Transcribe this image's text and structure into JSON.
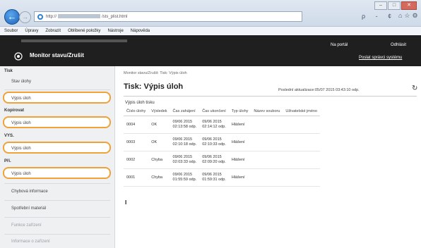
{
  "browser": {
    "address_text": "http://",
    "address_suffix": "/sts_plist.html",
    "search_hint": "ρ - ¢",
    "menu": [
      "Soubor",
      "Úpravy",
      "Zobrazit",
      "Oblíbené položky",
      "Nástroje",
      "Nápověda"
    ]
  },
  "header": {
    "title": "Monitor stavu/Zrušit",
    "portal_link": "Na portál",
    "logout_link": "Odhlásit",
    "send_link": "Poslat správci systému"
  },
  "sidebar": {
    "sections": [
      {
        "heading": "Tisk",
        "items": [
          {
            "label": "Stav úlohy"
          },
          {
            "label": "Výpis úloh"
          }
        ]
      },
      {
        "heading": "Kopírovat",
        "items": [
          {
            "label": "Výpis úloh"
          }
        ]
      },
      {
        "heading": "VYS.",
        "items": [
          {
            "label": "Výpis úloh"
          }
        ]
      },
      {
        "heading": "Při.",
        "items": [
          {
            "label": "Výpis úloh"
          }
        ]
      }
    ],
    "bottom_items": [
      {
        "label": "Chybová informace"
      },
      {
        "label": "Spotřební materiál"
      },
      {
        "label": "Funkce zařízení"
      },
      {
        "label": "Informace o zařízení"
      }
    ]
  },
  "main": {
    "breadcrumb": "Monitor stavu/Zrušit: Tisk: Výpis úloh",
    "title": "Tisk: Výpis úloh",
    "last_updated": "Poslední aktualizace:05/07 2015 03:43:10 odp.",
    "table_caption": "Výpis úloh tisku",
    "columns": [
      "Číslo úlohy",
      "Výsledek",
      "Čas zahájení",
      "Čas ukončení",
      "Typ úlohy",
      "Název souboru",
      "Uživatelské jméno"
    ],
    "rows": [
      {
        "num": "0004",
        "result": "OK",
        "start1": "09/06 2015",
        "start2": "02:13:58 odp.",
        "end1": "09/06 2015",
        "end2": "02:14:12 odp.",
        "type": "Hlášení",
        "file": "",
        "user": ""
      },
      {
        "num": "0003",
        "result": "OK",
        "start1": "09/06 2015",
        "start2": "02:10:18 odp.",
        "end1": "09/06 2015",
        "end2": "02:10:33 odp.",
        "type": "Hlášení",
        "file": "",
        "user": ""
      },
      {
        "num": "0002",
        "result": "Chyba",
        "start1": "09/06 2015",
        "start2": "02:03:33 odp.",
        "end1": "09/06 2015",
        "end2": "02:09:20 odp.",
        "type": "Hlášení",
        "file": "",
        "user": ""
      },
      {
        "num": "0001",
        "result": "Chyba",
        "start1": "09/06 2015",
        "start2": "01:55:59 odp.",
        "end1": "09/06 2015",
        "end2": "01:59:31 odp.",
        "type": "Hlášení",
        "file": "",
        "user": ""
      }
    ]
  },
  "colors": {
    "highlight": "#f0a23a",
    "header_bg": "#1f1f1f",
    "sidebar_bg": "#eef0f2"
  }
}
